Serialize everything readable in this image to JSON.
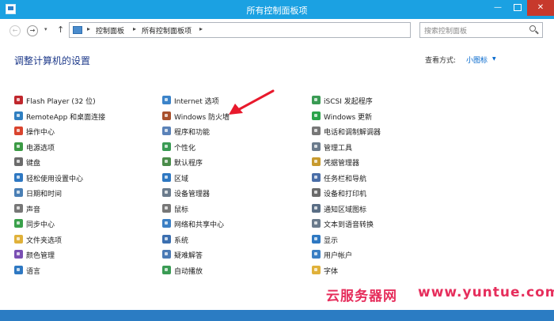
{
  "window": {
    "title": "所有控制面板项",
    "close_glyph": "✕",
    "min_glyph": "—"
  },
  "nav": {
    "back_glyph": "←",
    "forward_glyph": "→",
    "dropdown_glyph": "▾",
    "up_glyph": "↑"
  },
  "address": {
    "crumbs": [
      "控制面板",
      "所有控制面板项"
    ],
    "separator": "▸",
    "dropdown_glyph": "⌄",
    "refresh_glyph": "↻"
  },
  "search": {
    "placeholder": "搜索控制面板"
  },
  "header": {
    "title": "调整计算机的设置",
    "view_by_label": "查看方式:",
    "view_by_value": "小图标",
    "view_caret": "▼"
  },
  "columns": [
    [
      {
        "label": "Flash Player (32 位)",
        "icon": "flash-icon",
        "color": "#c0272d"
      },
      {
        "label": "RemoteApp 和桌面连接",
        "icon": "remoteapp-icon",
        "color": "#2f7fc1"
      },
      {
        "label": "操作中心",
        "icon": "action-center-flag-icon",
        "color": "#d9442e"
      },
      {
        "label": "电源选项",
        "icon": "power-options-icon",
        "color": "#3b9a44"
      },
      {
        "label": "键盘",
        "icon": "keyboard-icon",
        "color": "#6b6b6b"
      },
      {
        "label": "轻松使用设置中心",
        "icon": "ease-of-access-icon",
        "color": "#2e78c2"
      },
      {
        "label": "日期和时间",
        "icon": "clock-icon",
        "color": "#4a7fb5"
      },
      {
        "label": "声音",
        "icon": "speaker-icon",
        "color": "#777777"
      },
      {
        "label": "同步中心",
        "icon": "sync-center-icon",
        "color": "#3aa14b"
      },
      {
        "label": "文件夹选项",
        "icon": "folder-icon",
        "color": "#e0b13a"
      },
      {
        "label": "颜色管理",
        "icon": "color-management-icon",
        "color": "#7a4fb3"
      },
      {
        "label": "语言",
        "icon": "language-icon",
        "color": "#2e78c2"
      }
    ],
    [
      {
        "label": "Internet 选项",
        "icon": "internet-options-icon",
        "color": "#3b83c9"
      },
      {
        "label": "Windows 防火墙",
        "icon": "firewall-icon",
        "color": "#a8502c"
      },
      {
        "label": "程序和功能",
        "icon": "programs-icon",
        "color": "#5a82b8"
      },
      {
        "label": "个性化",
        "icon": "personalization-icon",
        "color": "#3a9b54"
      },
      {
        "label": "默认程序",
        "icon": "default-programs-icon",
        "color": "#4a8c4a"
      },
      {
        "label": "区域",
        "icon": "region-icon",
        "color": "#2e78c2"
      },
      {
        "label": "设备管理器",
        "icon": "device-manager-icon",
        "color": "#6b7b8c"
      },
      {
        "label": "鼠标",
        "icon": "mouse-icon",
        "color": "#777777"
      },
      {
        "label": "网络和共享中心",
        "icon": "network-icon",
        "color": "#3b7fc4"
      },
      {
        "label": "系统",
        "icon": "system-icon",
        "color": "#3b6fb0"
      },
      {
        "label": "疑难解答",
        "icon": "troubleshooting-icon",
        "color": "#4a7ab5"
      },
      {
        "label": "自动播放",
        "icon": "autoplay-icon",
        "color": "#3a9b54"
      }
    ],
    [
      {
        "label": "iSCSI 发起程序",
        "icon": "iscsi-icon",
        "color": "#3a9b54"
      },
      {
        "label": "Windows 更新",
        "icon": "windows-update-icon",
        "color": "#2aa34a"
      },
      {
        "label": "电话和调制解调器",
        "icon": "phone-modem-icon",
        "color": "#777777"
      },
      {
        "label": "管理工具",
        "icon": "admin-tools-icon",
        "color": "#6b7b8c"
      },
      {
        "label": "凭据管理器",
        "icon": "credential-manager-icon",
        "color": "#c79a2e"
      },
      {
        "label": "任务栏和导航",
        "icon": "taskbar-icon",
        "color": "#4a6ea8"
      },
      {
        "label": "设备和打印机",
        "icon": "printer-icon",
        "color": "#6b6b6b"
      },
      {
        "label": "通知区域图标",
        "icon": "notification-area-icon",
        "color": "#5a6e85"
      },
      {
        "label": "文本到语音转换",
        "icon": "text-to-speech-icon",
        "color": "#6b7b8c"
      },
      {
        "label": "显示",
        "icon": "display-icon",
        "color": "#2e78c2"
      },
      {
        "label": "用户帐户",
        "icon": "user-accounts-icon",
        "color": "#3a7fc4"
      },
      {
        "label": "字体",
        "icon": "fonts-icon",
        "color": "#e0b13a"
      }
    ]
  ],
  "colors": {
    "titlebar": "#1ba1e2",
    "close": "#c7392c",
    "heading": "#1e3a8a",
    "link": "#0066cc",
    "arrow": "#e8192c",
    "watermark": "#e62e5c"
  },
  "watermark": {
    "part1": "云服务器网",
    "part2": "www.yuntue.com"
  }
}
